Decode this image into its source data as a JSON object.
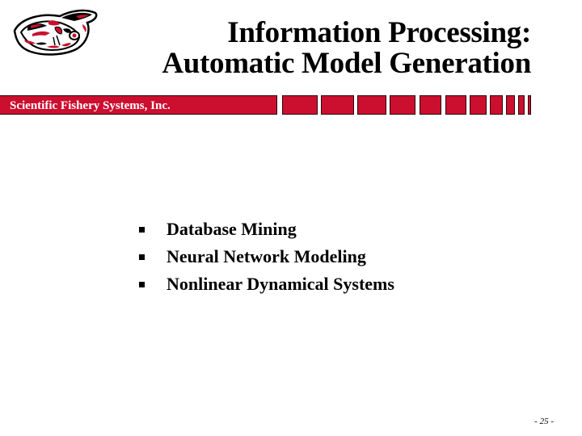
{
  "slide": {
    "title_lines": [
      "Information Processing:",
      "Automatic Model Generation"
    ],
    "company": "Scientific Fishery Systems, Inc.",
    "bullets": [
      "Database Mining",
      "Neural Network Modeling",
      "Nonlinear Dynamical Systems"
    ],
    "page_number": "- 25 -",
    "logo": "formline-salmon-logo"
  },
  "colors": {
    "brand_red": "#cc0e2f",
    "bar_border": "#2a0a0e",
    "text": "#000000",
    "background": "#ffffff"
  }
}
